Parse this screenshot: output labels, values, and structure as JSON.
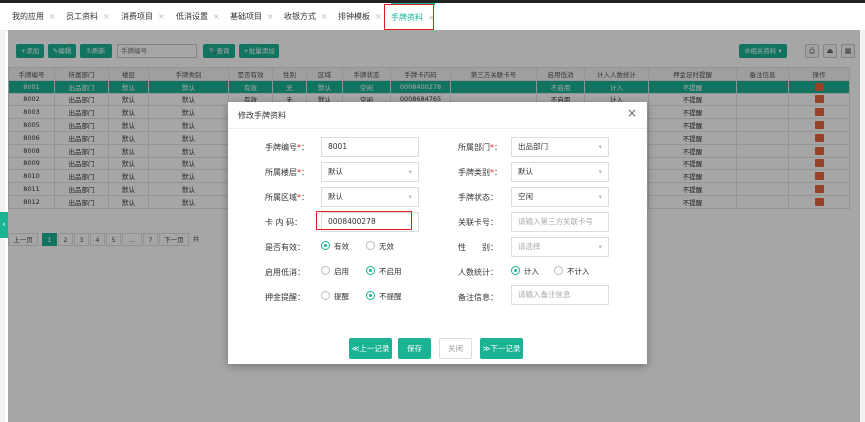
{
  "tabs": [
    {
      "label": "我的应用"
    },
    {
      "label": "员工资料"
    },
    {
      "label": "消费项目"
    },
    {
      "label": "低消设置"
    },
    {
      "label": "基础项目"
    },
    {
      "label": "收银方式"
    },
    {
      "label": "排钟模板"
    },
    {
      "label": "手牌资料"
    }
  ],
  "tab_close": "×",
  "toolbar": {
    "add": "+添加",
    "edit": "✎编辑",
    "refresh": "↻刷新",
    "search_placeholder": "手牌编号",
    "query": "🔍查询",
    "batch_add": "+批量添加",
    "related": "⚙相关资料 ▾"
  },
  "table": {
    "headers": [
      "手牌编号",
      "所属部门",
      "楼层",
      "手牌类别",
      "是否有效",
      "性别",
      "区域",
      "手牌状态",
      "手牌卡内码",
      "第三方关联卡号",
      "启用低消",
      "计入人数统计",
      "押金足时提醒",
      "备注信息",
      "操作"
    ],
    "rows": [
      [
        "8001",
        "出品部门",
        "默认",
        "默认",
        "有效",
        "无",
        "默认",
        "空闲",
        "0008400278",
        "",
        "不启用",
        "计入",
        "不提醒",
        "",
        ""
      ],
      [
        "8002",
        "出品部门",
        "默认",
        "默认",
        "有效",
        "无",
        "默认",
        "空闲",
        "0008684765",
        "",
        "不启用",
        "计入",
        "不提醒",
        "",
        ""
      ],
      [
        "8003",
        "出品部门",
        "默认",
        "默认",
        "",
        "",
        "",
        "",
        "",
        "",
        "",
        "",
        "不提醒",
        "",
        ""
      ],
      [
        "8005",
        "出品部门",
        "默认",
        "默认",
        "",
        "",
        "",
        "",
        "",
        "",
        "",
        "",
        "不提醒",
        "",
        ""
      ],
      [
        "8006",
        "出品部门",
        "默认",
        "默认",
        "",
        "",
        "",
        "",
        "",
        "",
        "",
        "",
        "不提醒",
        "",
        ""
      ],
      [
        "8008",
        "出品部门",
        "默认",
        "默认",
        "",
        "",
        "",
        "",
        "",
        "",
        "",
        "",
        "不提醒",
        "",
        ""
      ],
      [
        "8009",
        "出品部门",
        "默认",
        "默认",
        "",
        "",
        "",
        "",
        "",
        "",
        "",
        "",
        "不提醒",
        "",
        ""
      ],
      [
        "8010",
        "出品部门",
        "默认",
        "默认",
        "",
        "",
        "",
        "",
        "",
        "",
        "",
        "",
        "不提醒",
        "",
        ""
      ],
      [
        "8011",
        "出品部门",
        "默认",
        "默认",
        "",
        "",
        "",
        "",
        "",
        "",
        "",
        "",
        "不提醒",
        "",
        ""
      ],
      [
        "8012",
        "出品部门",
        "默认",
        "默认",
        "",
        "",
        "",
        "",
        "",
        "",
        "",
        "",
        "不提醒",
        "",
        ""
      ]
    ]
  },
  "pager": {
    "prev": "上一页",
    "pages": [
      "1",
      "2",
      "3",
      "4",
      "5",
      "...",
      "7"
    ],
    "next": "下一页",
    "tail": "共"
  },
  "modal": {
    "title": "修改手牌资料",
    "close": "×",
    "fields": {
      "card_no": {
        "label": "手牌编号",
        "value": "8001"
      },
      "dept": {
        "label": "所属部门",
        "value": "出品部门"
      },
      "floor": {
        "label": "所属楼层",
        "value": "默认"
      },
      "type": {
        "label": "手牌类别",
        "value": "默认"
      },
      "area": {
        "label": "所属区域",
        "value": "默认"
      },
      "status": {
        "label": "手牌状态",
        "value": "空闲"
      },
      "inner_code": {
        "label": "卡 内 码",
        "value": "0008400278"
      },
      "rel_card": {
        "label": "关联卡号",
        "placeholder": "请输入第三方关联卡号"
      },
      "valid": {
        "label": "是否有效",
        "options": [
          "有效",
          "无效"
        ],
        "selected": 0
      },
      "gender": {
        "label": "性　　别",
        "placeholder": "请选择"
      },
      "min_spend": {
        "label": "启用低消",
        "options": [
          "启用",
          "不启用"
        ],
        "selected": 1
      },
      "count": {
        "label": "人数统计",
        "options": [
          "计入",
          "不计入"
        ],
        "selected": 0
      },
      "deposit": {
        "label": "押金提醒",
        "options": [
          "提醒",
          "不提醒"
        ],
        "selected": 1
      },
      "remark": {
        "label": "备注信息",
        "placeholder": "请输入备注信息"
      }
    },
    "colon": "：",
    "required_mark": "*",
    "buttons": {
      "prev": "≪上一记录",
      "save": "保存",
      "close": "关闭",
      "next": "≫下一记录"
    }
  },
  "colors": {
    "accent": "#1ab394",
    "highlight": "#e02020",
    "delete": "#e8663c"
  }
}
